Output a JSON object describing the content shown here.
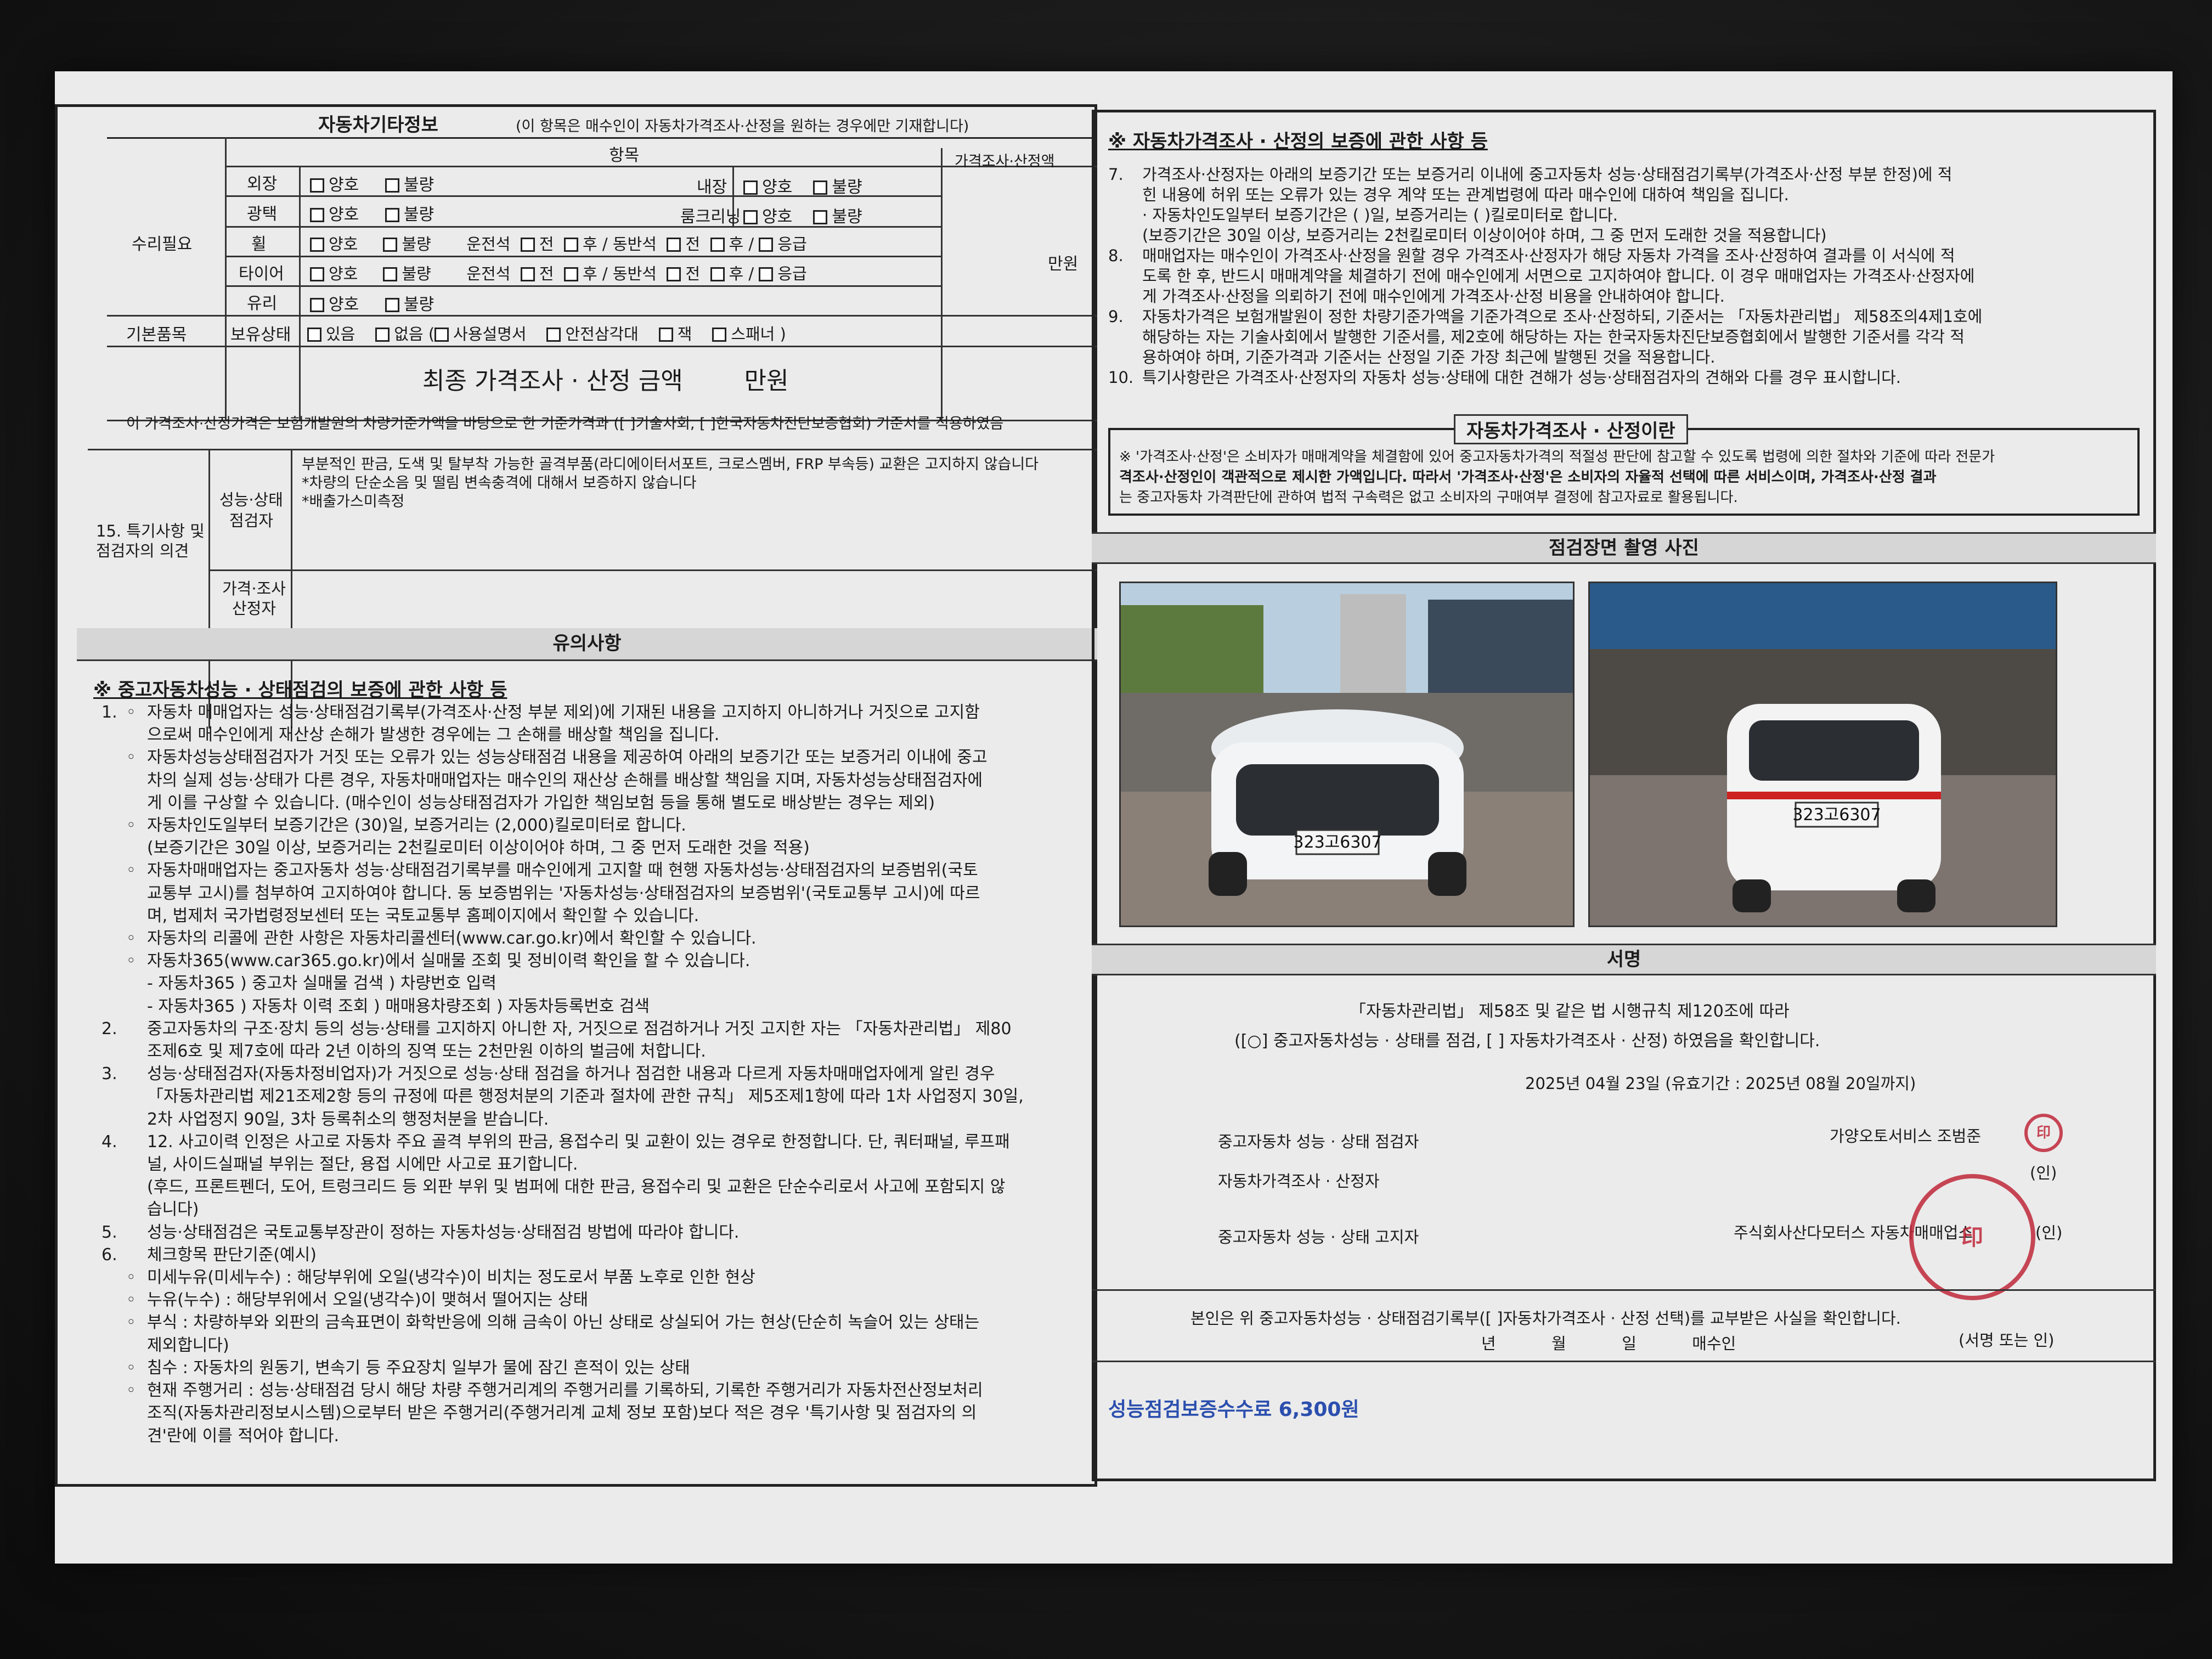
{
  "left": {
    "title": "자동차기타정보",
    "title_note": "(이 항목은 매수인이 자동차가격조사·산정을 원하는 경우에만 기재합니다)",
    "col_item": "항목",
    "col_price": "가격조사·산정액",
    "unit_manwon": "만원",
    "repair_label": "수리필요",
    "row_exterior": "외장",
    "row_gloss": "광택",
    "row_wheel": "휠",
    "row_tire": "타이어",
    "row_glass": "유리",
    "interior": "내장",
    "room_cleaning": "룸크리닝",
    "opt_good": "양호",
    "opt_bad": "불량",
    "driver_seat": "운전석",
    "passenger_seat": "동반석",
    "front": "전",
    "rear": "후",
    "spare": "응급",
    "basic_items": "기본품목",
    "owned": "보유상태",
    "opt_yes": "있음",
    "opt_no": "없음",
    "manual": "사용설명서",
    "triangle": "안전삼각대",
    "jack": "잭",
    "spanner": "스패너",
    "final_price": "최종 가격조사 · 산정 금액",
    "final_unit": "만원",
    "basis_text": "이 가격조사·산정가격은 보험개발원의 차량기준가액을 바탕으로 한 기준가격과 ([   ]기술사회, [   ]한국자동차진단보증협회) 기준서를 적용하였음",
    "special_label_1": "15. 특기사항 및",
    "special_label_2": "점검자의 의견",
    "perf_label_1": "성능·상태",
    "perf_label_2": "점검자",
    "perf_line_1": "부분적인 판금, 도색 및 탈부착 가능한 골격부품(라디에이터서포트, 크로스멤버, FRP 부속등) 교환은 고지하지 않습니다",
    "perf_line_2": "*차량의 단순소음 및 떨림 변속충격에 대해서 보증하지 않습니다",
    "perf_line_3": "*배출가스미측정",
    "price_label_1": "가격·조사",
    "price_label_2": "산정자",
    "notice_title": "유의사항",
    "warranty_heading": "※ 중고자동차성능 · 상태점검의 보증에 관한 사항 등",
    "notice_lines": [
      {
        "n": "1.",
        "b": "◦",
        "t": "자동차 매매업자는 성능·상태점검기록부(가격조사·산정 부분 제외)에 기재된 내용을 고지하지 아니하거나 거짓으로 고지함"
      },
      {
        "n": "",
        "b": "",
        "t": "으로써 매수인에게 재산상 손해가 발생한 경우에는 그 손해를 배상할 책임을 집니다."
      },
      {
        "n": "",
        "b": "◦",
        "t": "자동차성능상태점검자가 거짓 또는 오류가 있는 성능상태점검 내용을 제공하여 아래의 보증기간 또는 보증거리 이내에 중고"
      },
      {
        "n": "",
        "b": "",
        "t": "차의 실제 성능·상태가 다른 경우, 자동차매매업자는 매수인의 재산상 손해를 배상할 책임을 지며, 자동차성능상태점검자에"
      },
      {
        "n": "",
        "b": "",
        "t": "게 이를 구상할 수 있습니다. (매수인이 성능상태점검자가 가입한 책임보험 등을 통해 별도로 배상받는 경우는 제외)"
      },
      {
        "n": "",
        "b": "◦",
        "t": "자동차인도일부터 보증기간은 (30)일, 보증거리는 (2,000)킬로미터로 합니다."
      },
      {
        "n": "",
        "b": "",
        "t": "(보증기간은 30일 이상, 보증거리는 2천킬로미터 이상이어야 하며, 그 중 먼저 도래한 것을 적용)"
      },
      {
        "n": "",
        "b": "◦",
        "t": "자동차매매업자는 중고자동차 성능·상태점검기록부를 매수인에게 고지할 때 현행 자동차성능·상태점검자의 보증범위(국토"
      },
      {
        "n": "",
        "b": "",
        "t": "교통부 고시)를 첨부하여 고지하여야 합니다. 동 보증범위는 '자동차성능·상태점검자의 보증범위'(국토교통부 고시)에 따르"
      },
      {
        "n": "",
        "b": "",
        "t": "며, 법제처 국가법령정보센터 또는 국토교통부 홈페이지에서 확인할 수 있습니다."
      },
      {
        "n": "",
        "b": "◦",
        "t": "자동차의 리콜에 관한 사항은 자동차리콜센터(www.car.go.kr)에서 확인할 수 있습니다."
      },
      {
        "n": "",
        "b": "◦",
        "t": "자동차365(www.car365.go.kr)에서 실매물 조회 및 정비이력 확인을 할 수 있습니다."
      },
      {
        "n": "",
        "b": "",
        "t": "- 자동차365 ) 중고차 실매물 검색 ) 차량번호 입력"
      },
      {
        "n": "",
        "b": "",
        "t": "- 자동차365 ) 자동차 이력 조회 ) 매매용차량조회 ) 자동차등록번호 검색"
      },
      {
        "n": "2.",
        "b": "",
        "t": "중고자동차의 구조·장치 등의 성능·상태를 고지하지 아니한 자, 거짓으로 점검하거나 거짓 고지한 자는 「자동차관리법」 제80"
      },
      {
        "n": "",
        "b": "",
        "t": "조제6호 및 제7호에 따라 2년 이하의 징역 또는 2천만원 이하의 벌금에 처합니다."
      },
      {
        "n": "3.",
        "b": "",
        "t": "성능·상태점검자(자동차정비업자)가 거짓으로 성능·상태 점검을 하거나 점검한 내용과 다르게 자동차매매업자에게 알린 경우"
      },
      {
        "n": "",
        "b": "",
        "t": "「자동차관리법 제21조제2항 등의 규정에 따른 행정처분의 기준과 절차에 관한 규칙」 제5조제1항에 따라 1차 사업정지 30일,"
      },
      {
        "n": "",
        "b": "",
        "t": "2차 사업정지 90일, 3차 등록취소의 행정처분을 받습니다."
      },
      {
        "n": "4.",
        "b": "",
        "t": "12. 사고이력 인정은 사고로 자동차 주요 골격 부위의 판금, 용접수리 및 교환이 있는 경우로 한정합니다. 단, 쿼터패널, 루프패"
      },
      {
        "n": "",
        "b": "",
        "t": "널, 사이드실패널 부위는 절단, 용접 시에만 사고로 표기합니다."
      },
      {
        "n": "",
        "b": "",
        "t": "(후드, 프론트펜더, 도어, 트렁크리드 등 외판 부위 및 범퍼에 대한 판금, 용접수리 및 교환은 단순수리로서 사고에 포함되지 않"
      },
      {
        "n": "",
        "b": "",
        "t": "습니다)"
      },
      {
        "n": "5.",
        "b": "",
        "t": "성능·상태점검은 국토교통부장관이 정하는 자동차성능·상태점검 방법에 따라야 합니다."
      },
      {
        "n": "6.",
        "b": "",
        "t": "체크항목 판단기준(예시)"
      },
      {
        "n": "",
        "b": "◦",
        "t": "미세누유(미세누수) : 해당부위에 오일(냉각수)이 비치는 정도로서 부품 노후로 인한 현상"
      },
      {
        "n": "",
        "b": "◦",
        "t": "누유(누수) : 해당부위에서 오일(냉각수)이 맺혀서 떨어지는 상태"
      },
      {
        "n": "",
        "b": "◦",
        "t": "부식 : 차량하부와 외판의 금속표면이 화학반응에 의해 금속이 아닌 상태로 상실되어 가는 현상(단순히 녹슬어 있는 상태는"
      },
      {
        "n": "",
        "b": "",
        "t": "제외합니다)"
      },
      {
        "n": "",
        "b": "◦",
        "t": "침수 : 자동차의 원동기, 변속기 등 주요장치 일부가 물에 잠긴 흔적이 있는 상태"
      },
      {
        "n": "",
        "b": "◦",
        "t": "현재 주행거리 : 성능·상태점검 당시 해당 차량 주행거리계의 주행거리를 기록하되, 기록한 주행거리가 자동차전산정보처리"
      },
      {
        "n": "",
        "b": "",
        "t": "조직(자동차관리정보시스템)으로부터 받은 주행거리(주행거리계 교체 정보 포함)보다 적은 경우 '특기사항 및 점검자의 의"
      },
      {
        "n": "",
        "b": "",
        "t": "견'란에 이를 적어야 합니다."
      }
    ]
  },
  "right": {
    "heading": "※ 자동차가격조사 · 산정의 보증에 관한 사항 등",
    "items": [
      {
        "n": "7.",
        "t": "가격조사·산정자는 아래의 보증기간 또는 보증거리 이내에 중고자동차 성능·상태점검기록부(가격조사·산정 부분 한정)에 적"
      },
      {
        "n": "",
        "t": "힌 내용에 허위 또는 오류가 있는 경우 계약 또는 관계법령에 따라 매수인에 대하여 책임을 집니다."
      },
      {
        "n": "",
        "t": "· 자동차인도일부터 보증기간은 ( )일, 보증거리는 ( )킬로미터로 합니다."
      },
      {
        "n": "",
        "t": "(보증기간은 30일 이상, 보증거리는 2천킬로미터 이상이어야 하며, 그 중 먼저 도래한 것을 적용합니다)"
      },
      {
        "n": "8.",
        "t": "매매업자는 매수인이 가격조사·산정을 원할 경우 가격조사·산정자가 해당 자동차 가격을 조사·산정하여 결과를 이 서식에 적"
      },
      {
        "n": "",
        "t": "도록 한 후, 반드시 매매계약을 체결하기 전에 매수인에게 서면으로 고지하여야 합니다. 이 경우 매매업자는 가격조사·산정자에"
      },
      {
        "n": "",
        "t": "게 가격조사·산정을 의뢰하기 전에 매수인에게 가격조사·산정 비용을 안내하여야 합니다."
      },
      {
        "n": "9.",
        "t": "자동차가격은 보험개발원이 정한 차량기준가액을 기준가격으로 조사·산정하되, 기준서는 「자동차관리법」 제58조의4제1호에"
      },
      {
        "n": "",
        "t": "해당하는 자는 기술사회에서 발행한 기준서를, 제2호에 해당하는 자는 한국자동차진단보증협회에서 발행한 기준서를 각각 적"
      },
      {
        "n": "",
        "t": "용하여야 하며, 기준가격과 기준서는 산정일 기준 가장 최근에 발행된 것을 적용합니다."
      },
      {
        "n": "10.",
        "t": "특기사항란은 가격조사·산정자의 자동차 성능·상태에 대한 견해가 성능·상태점검자의 견해와 다를 경우 표시합니다."
      }
    ],
    "box_title": "자동차가격조사 · 산정이란",
    "box_line_1": "※ '가격조사·산정'은 소비자가 매매계약을 체결함에 있어 중고자동차가격의 적절성 판단에 참고할 수 있도록 법령에 의한 절차와 기준에 따라 전문가",
    "box_line_2": "격조사·산정인이 객관적으로 제시한 가액입니다. 따라서 '가격조사·산정'은 소비자의 자율적 선택에 따른 서비스이며, 가격조사·산정 결과",
    "box_line_3": "는 중고자동차 가격판단에 관하여 법적 구속력은 없고 소비자의 구매여부 결정에 참고자료로 활용됩니다.",
    "photo_title": "점검장면 촬영 사진",
    "plate_front": "323고6307",
    "plate_rear": "323고6307",
    "sign_title": "서명",
    "sign_line_1": "「자동차관리법」 제58조 및 같은 법 시행규칙 제120조에 따라",
    "sign_line_2": "([○] 중고자동차성능 · 상태를 점검, [    ] 자동차가격조사 · 산정) 하였음을 확인합니다.",
    "sign_date": "2025년 04월 23일  (유효기간 : 2025년 08월 20일까지)",
    "inspector_label": "중고자동차 성능 · 상태 점검자",
    "inspector_name": "가양오토서비스 조범준",
    "price_label": "자동차가격조사 · 산정자",
    "notifier_label": "중고자동차 성능 · 상태 고지자",
    "notifier_name": "주식회사산다모터스 자동차매매업소",
    "seal_in": "(인)",
    "receipt_line": "본인은 위 중고자동차성능 · 상태점검기록부([   ]자동차가격조사 · 산정 선택)를 교부받은 사실을 확인합니다.",
    "receipt_year": "년",
    "receipt_month": "월",
    "receipt_day": "일",
    "receipt_buyer": "매수인",
    "receipt_sign": "(서명 또는 인)",
    "fee": "성능점검보증수수료 6,300원",
    "colors": {
      "fee": "#2b4fae",
      "stamp": "#c0283a"
    }
  }
}
